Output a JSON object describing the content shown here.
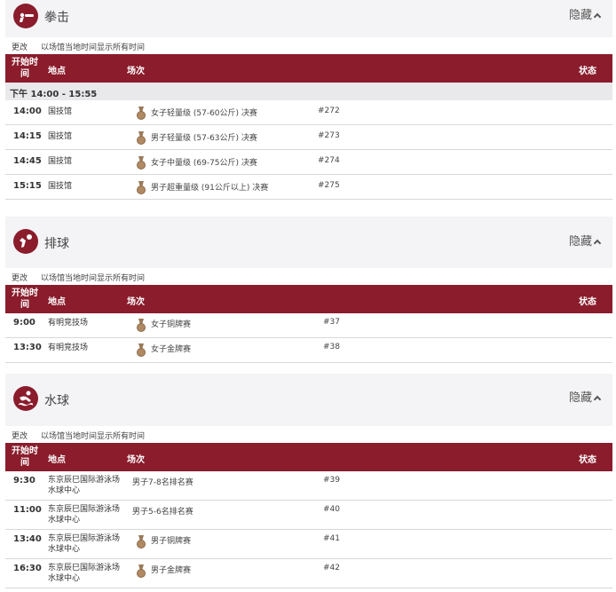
{
  "common": {
    "hide_label": "隐藏",
    "change_label": "更改",
    "tz_note": "以场馆当地时间显示所有时间",
    "col_time": "开始时间",
    "col_venue": "地点",
    "col_event": "场次",
    "col_status": "状态",
    "medal_icon": "bronze-medal-icon",
    "accent_color": "#8a1c2c"
  },
  "sections": [
    {
      "sport": "拳击",
      "icon": "boxing-icon",
      "period": "下午  14:00 - 15:55",
      "rows": [
        {
          "time": "14:00",
          "venue": "国技馆",
          "event": "女子轻量级 (57-60公斤) 决赛",
          "code": "#272",
          "medal": true
        },
        {
          "time": "14:15",
          "venue": "国技馆",
          "event": "男子轻量级 (57-63公斤) 决赛",
          "code": "#273",
          "medal": true
        },
        {
          "time": "14:45",
          "venue": "国技馆",
          "event": "女子中量级 (69-75公斤) 决赛",
          "code": "#274",
          "medal": true
        },
        {
          "time": "15:15",
          "venue": "国技馆",
          "event": "男子超重量级 (91公斤以上) 决赛",
          "code": "#275",
          "medal": true
        }
      ]
    },
    {
      "sport": "排球",
      "icon": "volleyball-icon",
      "rows": [
        {
          "time": "9:00",
          "venue": "有明竞技场",
          "event": "女子铜牌赛",
          "code": "#37",
          "medal": true
        },
        {
          "time": "13:30",
          "venue": "有明竞技场",
          "event": "女子金牌赛",
          "code": "#38",
          "medal": true
        }
      ]
    },
    {
      "sport": "水球",
      "icon": "water-polo-icon",
      "rows": [
        {
          "time": "9:30",
          "venue": "东京辰巳国际游泳场水球中心",
          "event": "男子7-8名排名赛",
          "code": "#39",
          "medal": false
        },
        {
          "time": "11:00",
          "venue": "东京辰巳国际游泳场水球中心",
          "event": "男子5-6名排名赛",
          "code": "#40",
          "medal": false
        },
        {
          "time": "13:40",
          "venue": "东京辰巳国际游泳场水球中心",
          "event": "男子铜牌赛",
          "code": "#41",
          "medal": true
        },
        {
          "time": "16:30",
          "venue": "东京辰巳国际游泳场水球中心",
          "event": "男子金牌赛",
          "code": "#42",
          "medal": true
        }
      ]
    }
  ]
}
